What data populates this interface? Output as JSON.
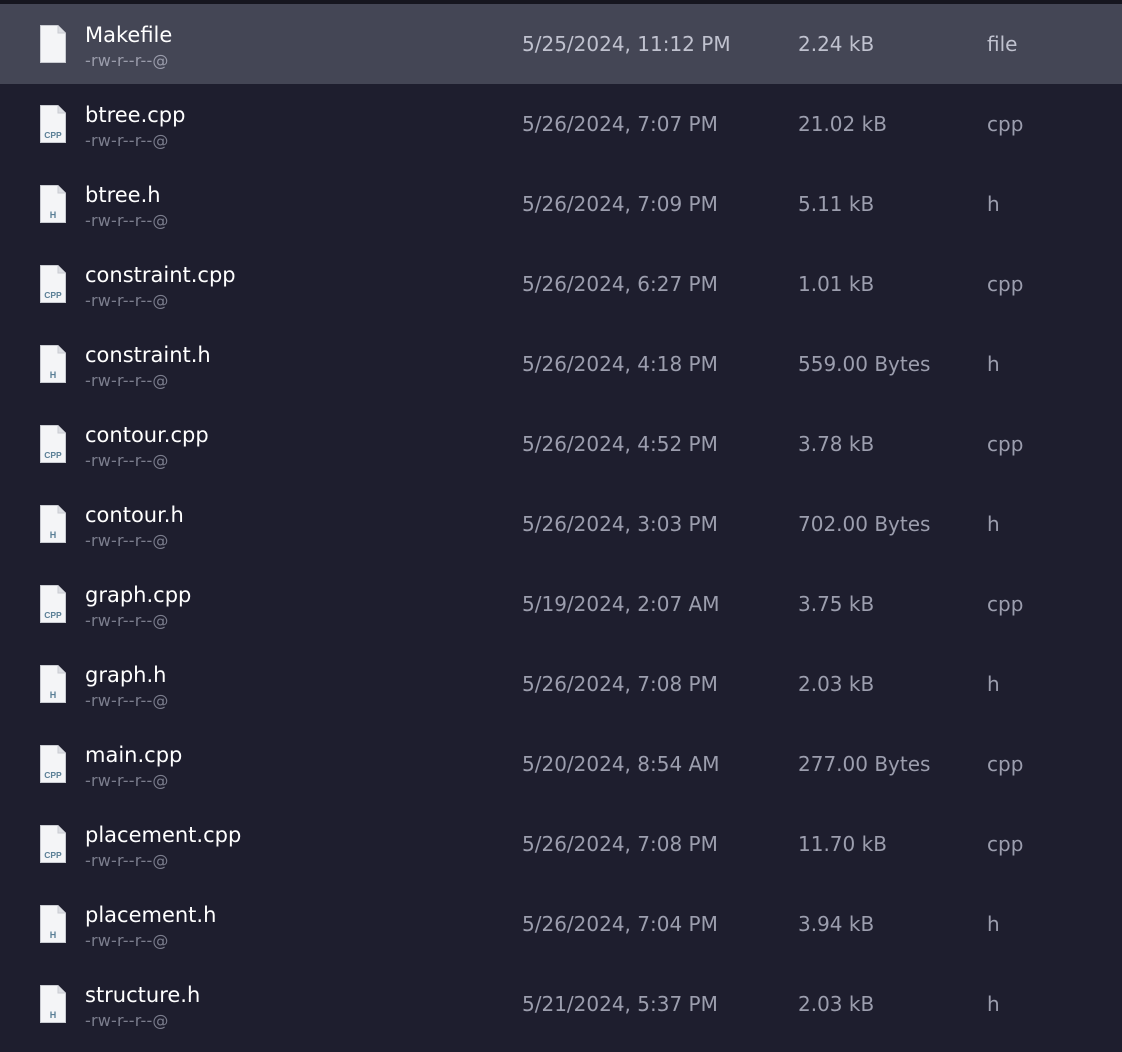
{
  "files": [
    {
      "name": "Makefile",
      "perms": "-rw-r--r--@",
      "date": "5/25/2024, 11:12 PM",
      "size": "2.24 kB",
      "kind": "file",
      "icon": "generic-file-icon",
      "badge": "",
      "selected": true
    },
    {
      "name": "btree.cpp",
      "perms": "-rw-r--r--@",
      "date": "5/26/2024, 7:07 PM",
      "size": "21.02 kB",
      "kind": "cpp",
      "icon": "cpp-file-icon",
      "badge": "CPP",
      "selected": false
    },
    {
      "name": "btree.h",
      "perms": "-rw-r--r--@",
      "date": "5/26/2024, 7:09 PM",
      "size": "5.11 kB",
      "kind": "h",
      "icon": "header-file-icon",
      "badge": "H",
      "selected": false
    },
    {
      "name": "constraint.cpp",
      "perms": "-rw-r--r--@",
      "date": "5/26/2024, 6:27 PM",
      "size": "1.01 kB",
      "kind": "cpp",
      "icon": "cpp-file-icon",
      "badge": "CPP",
      "selected": false
    },
    {
      "name": "constraint.h",
      "perms": "-rw-r--r--@",
      "date": "5/26/2024, 4:18 PM",
      "size": "559.00 Bytes",
      "kind": "h",
      "icon": "header-file-icon",
      "badge": "H",
      "selected": false
    },
    {
      "name": "contour.cpp",
      "perms": "-rw-r--r--@",
      "date": "5/26/2024, 4:52 PM",
      "size": "3.78 kB",
      "kind": "cpp",
      "icon": "cpp-file-icon",
      "badge": "CPP",
      "selected": false
    },
    {
      "name": "contour.h",
      "perms": "-rw-r--r--@",
      "date": "5/26/2024, 3:03 PM",
      "size": "702.00 Bytes",
      "kind": "h",
      "icon": "header-file-icon",
      "badge": "H",
      "selected": false
    },
    {
      "name": "graph.cpp",
      "perms": "-rw-r--r--@",
      "date": "5/19/2024, 2:07 AM",
      "size": "3.75 kB",
      "kind": "cpp",
      "icon": "cpp-file-icon",
      "badge": "CPP",
      "selected": false
    },
    {
      "name": "graph.h",
      "perms": "-rw-r--r--@",
      "date": "5/26/2024, 7:08 PM",
      "size": "2.03 kB",
      "kind": "h",
      "icon": "header-file-icon",
      "badge": "H",
      "selected": false
    },
    {
      "name": "main.cpp",
      "perms": "-rw-r--r--@",
      "date": "5/20/2024, 8:54 AM",
      "size": "277.00 Bytes",
      "kind": "cpp",
      "icon": "cpp-file-icon",
      "badge": "CPP",
      "selected": false
    },
    {
      "name": "placement.cpp",
      "perms": "-rw-r--r--@",
      "date": "5/26/2024, 7:08 PM",
      "size": "11.70 kB",
      "kind": "cpp",
      "icon": "cpp-file-icon",
      "badge": "CPP",
      "selected": false
    },
    {
      "name": "placement.h",
      "perms": "-rw-r--r--@",
      "date": "5/26/2024, 7:04 PM",
      "size": "3.94 kB",
      "kind": "h",
      "icon": "header-file-icon",
      "badge": "H",
      "selected": false
    },
    {
      "name": "structure.h",
      "perms": "-rw-r--r--@",
      "date": "5/21/2024, 5:37 PM",
      "size": "2.03 kB",
      "kind": "h",
      "icon": "header-file-icon",
      "badge": "H",
      "selected": false
    }
  ],
  "colors": {
    "background": "#1e1e2e",
    "selected_row": "#444655",
    "name_text": "#ffffff",
    "meta_text": "#9c9eae",
    "perms_text": "#7b7d8d",
    "icon_badge": "#5a7f96"
  }
}
